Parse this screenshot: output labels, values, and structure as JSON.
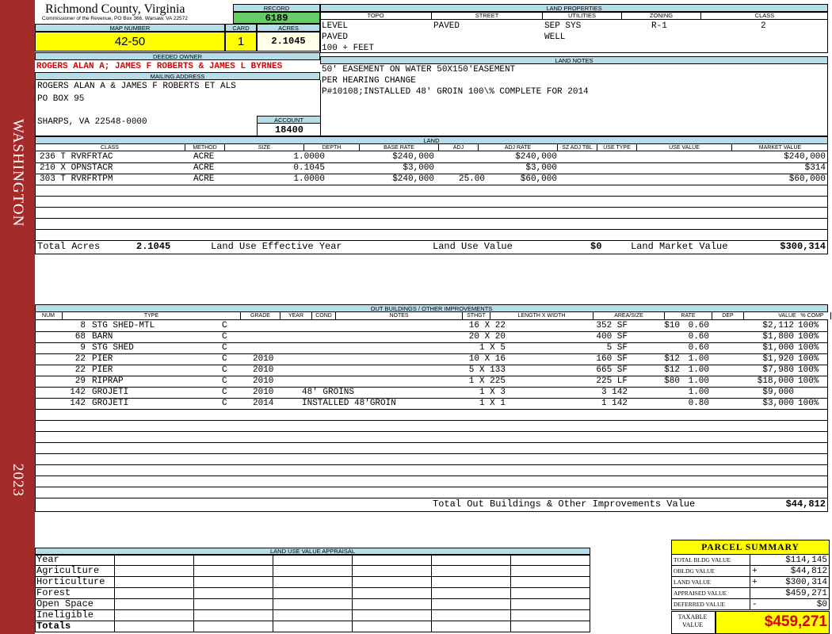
{
  "sidebar": {
    "district": "WASHINGTON",
    "year": "2023"
  },
  "header": {
    "county": "Richmond County, Virginia",
    "commissioner": "Commissioner of the Revenue, PO Box 366, Warsaw, VA 22572",
    "record_label": "RECORD",
    "record": "6189",
    "map_number_label": "MAP NUMBER",
    "map_number": "42-50",
    "card_label": "CARD",
    "card": "1",
    "acres_label": "ACRES",
    "acres": "2.1045"
  },
  "owner": {
    "deeded_label": "DEEDED OWNER",
    "deeded": "ROGERS ALAN A; JAMES F ROBERTS & JAMES L BYRNES",
    "mailing_label": "MAILING ADDRESS",
    "mailing": [
      "ROGERS ALAN A & JAMES F ROBERTS ET ALS",
      "PO BOX 95",
      "",
      "SHARPS, VA 22548-0000"
    ],
    "account_label": "ACCOUNT",
    "account": "18400"
  },
  "land_properties": {
    "title": "LAND PROPERTIES",
    "headers": [
      "TOPO",
      "STREET",
      "UTILITIES",
      "ZONING",
      "CLASS"
    ],
    "topo": [
      "LEVEL",
      "PAVED",
      "100 + FEET"
    ],
    "street": [
      "PAVED"
    ],
    "utilities": [
      "SEP SYS",
      "WELL"
    ],
    "zoning": "R-1",
    "class": "2"
  },
  "land_notes": {
    "title": "LAND NOTES",
    "lines": [
      "50' EASEMENT ON WATER 50X150'EASEMENT",
      "PER HEARING CHANGE",
      "P#10108;INSTALLED 48' GROIN 100\\% COMPLETE FOR 2014"
    ]
  },
  "land": {
    "title": "LAND",
    "headers": [
      "CLASS",
      "METHOD",
      "SIZE",
      "DEPTH",
      "BASE RATE",
      "ADJ",
      "ADJ RATE",
      "SZ ADJ TBL",
      "USE TYPE",
      "USE VALUE",
      "MARKET VALUE"
    ],
    "rows": [
      {
        "class": "236 T RVRFRTAC",
        "method": "ACRE",
        "size": "1.0000",
        "depth": "",
        "base_rate": "$240,000",
        "adj": "",
        "adj_rate": "$240,000",
        "market": "$240,000"
      },
      {
        "class": "210 X OPNSTACR",
        "method": "ACRE",
        "size": "0.1045",
        "depth": "",
        "base_rate": "$3,000",
        "adj": "",
        "adj_rate": "$3,000",
        "market": "$314"
      },
      {
        "class": "303 T RVRFRTPM",
        "method": "ACRE",
        "size": "1.0000",
        "depth": "",
        "base_rate": "$240,000",
        "adj": "25.00",
        "adj_rate": "$60,000",
        "market": "$60,000"
      }
    ],
    "total_acres_label": "Total Acres",
    "total_acres": "2.1045",
    "luey_label": "Land Use Effective Year",
    "luv_label": "Land Use Value",
    "luv": "$0",
    "lmv_label": "Land Market Value",
    "lmv": "$300,314"
  },
  "outbuildings": {
    "title": "OUT BUILDINGS / OTHER IMPROVEMENTS",
    "headers": [
      "NUM",
      "TYPE",
      "GRADE",
      "YEAR",
      "COND",
      "NOTES",
      "STHGT",
      "LENGTH X WIDTH",
      "AREA/SIZE",
      "RATE",
      "DEP",
      "VALUE",
      "% COMP"
    ],
    "rows": [
      {
        "num": "8",
        "type": "STG SHED-MTL",
        "grade": "C",
        "year": "",
        "notes": "",
        "lw": "16 X 22",
        "area": "352 SF",
        "rate": "$10",
        "dep": "0.60",
        "value": "$2,112",
        "comp": "100%"
      },
      {
        "num": "68",
        "type": "BARN",
        "grade": "C",
        "year": "",
        "notes": "",
        "lw": "20 X 20",
        "area": "400 SF",
        "rate": "",
        "dep": "0.60",
        "value": "$1,800",
        "comp": "100%"
      },
      {
        "num": "9",
        "type": "STG SHED",
        "grade": "C",
        "year": "",
        "notes": "",
        "lw": "1 X 5",
        "area": "5 SF",
        "rate": "",
        "dep": "0.60",
        "value": "$1,000",
        "comp": "100%"
      },
      {
        "num": "22",
        "type": "PIER",
        "grade": "C",
        "year": "2010",
        "notes": "",
        "lw": "10 X 16",
        "area": "160 SF",
        "rate": "$12",
        "dep": "1.00",
        "value": "$1,920",
        "comp": "100%"
      },
      {
        "num": "22",
        "type": "PIER",
        "grade": "C",
        "year": "2010",
        "notes": "",
        "lw": "5 X 133",
        "area": "665 SF",
        "rate": "$12",
        "dep": "1.00",
        "value": "$7,980",
        "comp": "100%"
      },
      {
        "num": "29",
        "type": "RIPRAP",
        "grade": "C",
        "year": "2010",
        "notes": "",
        "lw": "1 X 225",
        "area": "225 LF",
        "rate": "$80",
        "dep": "1.00",
        "value": "$18,000",
        "comp": "100%"
      },
      {
        "num": "142",
        "type": "GROJETI",
        "grade": "C",
        "year": "2010",
        "notes": "48' GROINS",
        "lw": "1 X 3",
        "area": "3 142",
        "rate": "",
        "dep": "1.00",
        "value": "$9,000",
        "comp": ""
      },
      {
        "num": "142",
        "type": "GROJETI",
        "grade": "C",
        "year": "2014",
        "notes": "INSTALLED 48'GROIN",
        "lw": "1 X 1",
        "area": "1 142",
        "rate": "",
        "dep": "0.80",
        "value": "$3,000",
        "comp": "100%"
      }
    ],
    "total_label": "Total Out Buildings & Other Improvements Value",
    "total": "$44,812"
  },
  "luva": {
    "title": "LAND USE VALUE APPRAISAL",
    "rows": [
      "Year",
      "Agriculture",
      "Horticulture",
      "Forest",
      "Open Space",
      "Ineligible",
      "Totals"
    ]
  },
  "summary": {
    "title": "PARCEL SUMMARY",
    "rows": [
      {
        "label": "TOTAL BLDG VALUE",
        "sign": "",
        "value": "$114,145"
      },
      {
        "label": "OBLDG VALUE",
        "sign": "+",
        "value": "$44,812"
      },
      {
        "label": "LAND VALUE",
        "sign": "+",
        "value": "$300,314"
      },
      {
        "label": "APPRAISED VALUE",
        "sign": "",
        "value": "$459,271"
      },
      {
        "label": "DEFERRED VALUE",
        "sign": "-",
        "value": "$0"
      }
    ],
    "taxable_label": "TAXABLE VALUE",
    "taxable": "$459,271"
  }
}
